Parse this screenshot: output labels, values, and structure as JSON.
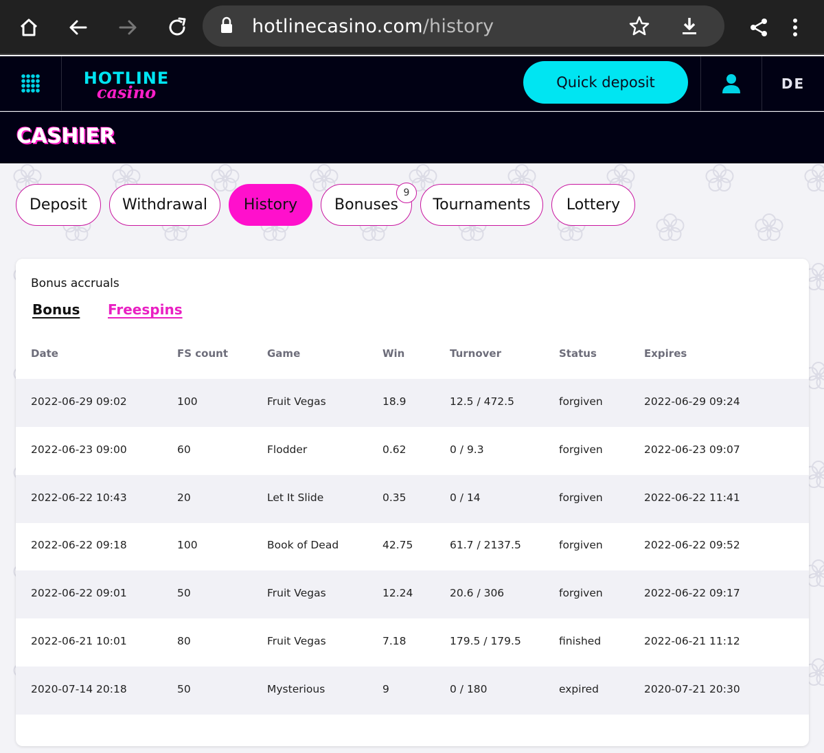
{
  "browser": {
    "url_host": "hotlinecasino.com",
    "url_path": "/history"
  },
  "header": {
    "logo_top": "HOTLINE",
    "logo_bottom": "casino",
    "quick_deposit_label": "Quick deposit",
    "language": "DE"
  },
  "cashier": {
    "title": "CASHIER"
  },
  "tabs": [
    {
      "label": "Deposit",
      "active": false
    },
    {
      "label": "Withdrawal",
      "active": false
    },
    {
      "label": "History",
      "active": true
    },
    {
      "label": "Bonuses",
      "active": false,
      "badge": "9"
    },
    {
      "label": "Tournaments",
      "active": false
    },
    {
      "label": "Lottery",
      "active": false
    }
  ],
  "section": {
    "title": "Bonus accruals",
    "subtabs": [
      "Bonus",
      "Freespins"
    ]
  },
  "table": {
    "headers": [
      "Date",
      "FS count",
      "Game",
      "Win",
      "Turnover",
      "Status",
      "Expires"
    ],
    "rows": [
      [
        "2022-06-29 09:02",
        "100",
        "Fruit Vegas",
        "18.9",
        "12.5 / 472.5",
        "forgiven",
        "2022-06-29 09:24"
      ],
      [
        "2022-06-23 09:00",
        "60",
        "Flodder",
        "0.62",
        "0 / 9.3",
        "forgiven",
        "2022-06-23 09:07"
      ],
      [
        "2022-06-22 10:43",
        "20",
        "Let It Slide",
        "0.35",
        "0 / 14",
        "forgiven",
        "2022-06-22 11:41"
      ],
      [
        "2022-06-22 09:18",
        "100",
        "Book of Dead",
        "42.75",
        "61.7 / 2137.5",
        "forgiven",
        "2022-06-22 09:52"
      ],
      [
        "2022-06-22 09:01",
        "50",
        "Fruit Vegas",
        "12.24",
        "20.6 / 306",
        "forgiven",
        "2022-06-22 09:17"
      ],
      [
        "2022-06-21 10:01",
        "80",
        "Fruit Vegas",
        "7.18",
        "179.5 / 179.5",
        "finished",
        "2022-06-21 11:12"
      ],
      [
        "2020-07-14 20:18",
        "50",
        "Mysterious",
        "9",
        "0 / 180",
        "expired",
        "2020-07-21 20:30"
      ]
    ]
  },
  "colors": {
    "accent_pink": "#ff10cc",
    "accent_cyan": "#00e5f2",
    "header_bg": "#010114"
  }
}
